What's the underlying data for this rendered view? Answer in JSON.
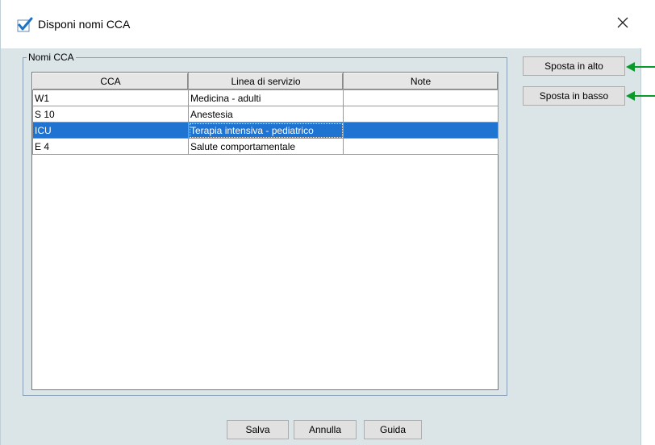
{
  "window": {
    "title": "Disponi nomi CCA"
  },
  "group": {
    "legend": "Nomi CCA"
  },
  "table": {
    "columns": [
      "CCA",
      "Linea di servizio",
      "Note"
    ],
    "rows": [
      {
        "cca": "W1",
        "service_line": "Medicina - adulti",
        "note": "",
        "selected": false
      },
      {
        "cca": "S 10",
        "service_line": "Anestesia",
        "note": "",
        "selected": false
      },
      {
        "cca": "ICU",
        "service_line": "Terapia intensiva - pediatrico",
        "note": "",
        "selected": true
      },
      {
        "cca": "E 4",
        "service_line": "Salute comportamentale",
        "note": "",
        "selected": false
      }
    ]
  },
  "side_buttons": {
    "move_up": "Sposta in alto",
    "move_down": "Sposta in basso"
  },
  "footer": {
    "save": "Salva",
    "cancel": "Annulla",
    "help": "Guida"
  },
  "colors": {
    "selection": "#1f73d1",
    "window_bg": "#dbe5e8",
    "arrow": "#0a9a2a",
    "check_icon": "#1a73c8"
  }
}
